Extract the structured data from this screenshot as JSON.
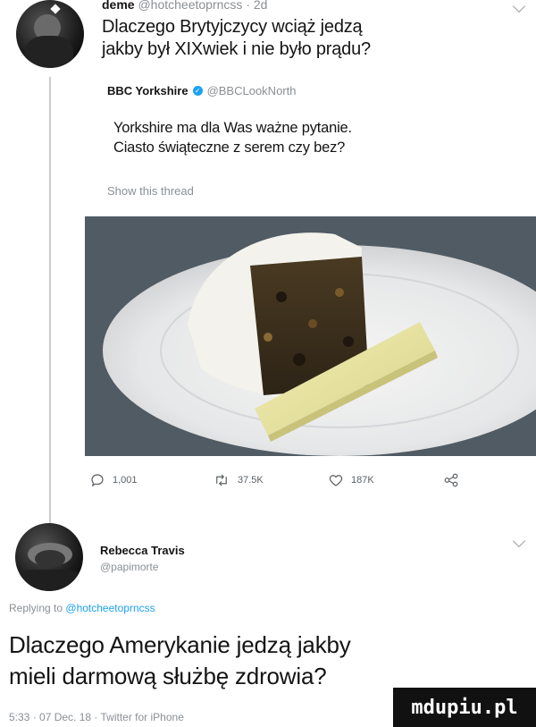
{
  "tweet1": {
    "display_name": "deme",
    "handle": "@hotcheetoprncss",
    "sep": "·",
    "time": "2d",
    "text_line1": "Dlaczego Brytyjczycy wciąż jedzą",
    "text_line2": "jakby był XIXwiek i nie było prądu?",
    "quoted": {
      "display_name": "BBC Yorkshire",
      "verified_icon": "verified-badge-icon",
      "handle": "@BBCLookNorth",
      "text_line1": "Yorkshire ma dla Was ważne pytanie.",
      "text_line2": "Ciasto świąteczne z serem czy bez?",
      "show_thread": "Show this thread"
    },
    "actions": {
      "reply_count": "1,001",
      "retweet_count": "37.5K",
      "like_count": "187K"
    }
  },
  "tweet2": {
    "display_name": "Rebecca Travis",
    "handle": "@papimorte",
    "replying_prefix": "Replying to",
    "replying_handle": "@hotcheetoprncss",
    "text_line1": "Dlaczego Amerykanie jedzą jakby",
    "text_line2": "mieli darmową służbę zdrowia?",
    "footer": "5:33 · 07 Dec. 18 · Twitter for iPhone"
  },
  "watermark": "mdupiu.pl",
  "colors": {
    "link_blue": "#1da1f2",
    "handle_grey": "#8a8f94",
    "text": "#141414",
    "photo_bg": "#4e5961"
  }
}
